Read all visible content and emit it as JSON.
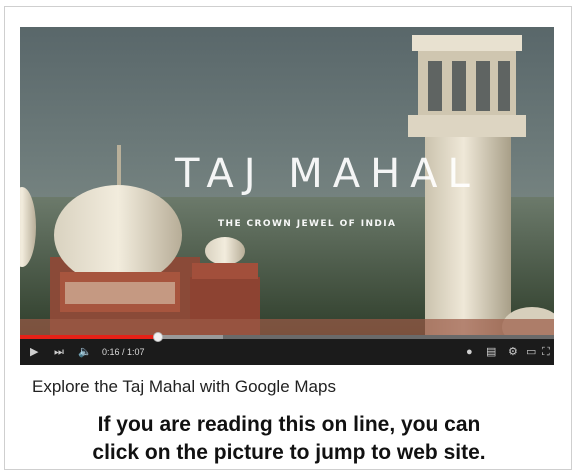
{
  "video": {
    "title_overlay": "TAJ MAHAL",
    "subtitle_overlay": "THE CROWN JEWEL OF INDIA",
    "time_current": "0:16",
    "time_total": "1:07",
    "progress_fraction": 0.258
  },
  "caption": {
    "text": "Explore the Taj Mahal with Google Maps"
  },
  "footer": {
    "line1": "If you are reading this on line, you can",
    "line2": "click on the picture to jump to web site."
  },
  "icons": [
    "play-icon",
    "next-icon",
    "volume-icon",
    "info-icon",
    "captions-icon",
    "settings-icon",
    "theater-icon",
    "fullscreen-icon"
  ]
}
